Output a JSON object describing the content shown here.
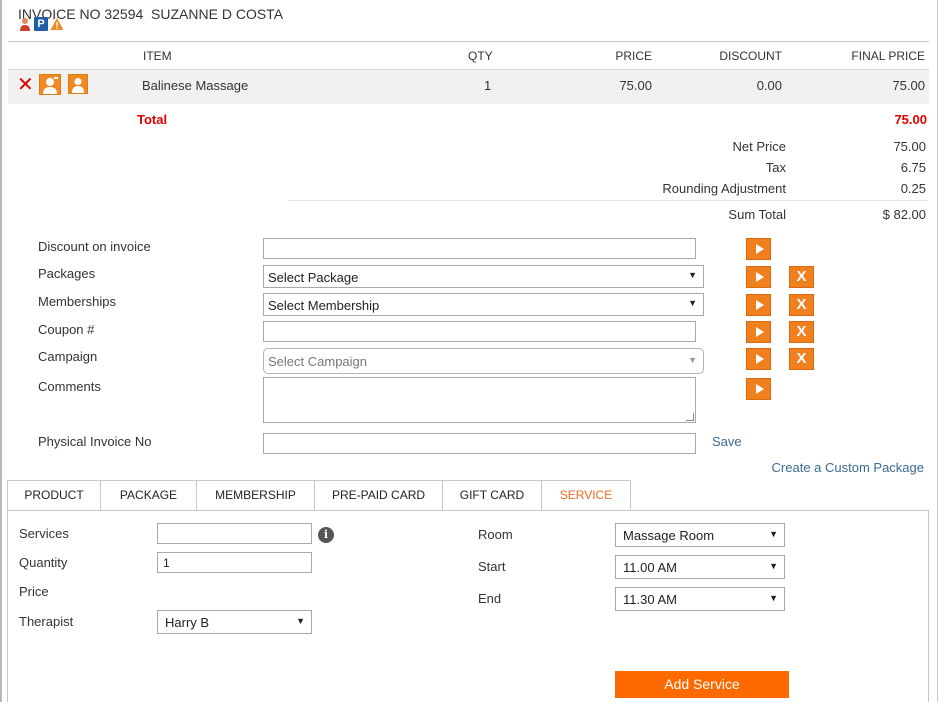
{
  "header": {
    "title": "INVOICE NO 32594  SUZANNE D COSTA",
    "icons": [
      "person-icon",
      "parking-icon",
      "warning-icon"
    ]
  },
  "table": {
    "columns": [
      "ITEM",
      "QTY",
      "PRICE",
      "DISCOUNT",
      "FINAL PRICE"
    ],
    "rows": [
      {
        "item": "Balinese Massage",
        "qty": "1",
        "price": "75.00",
        "discount": "0.00",
        "final_price": "75.00"
      }
    ],
    "total_label": "Total",
    "total_value": "75.00"
  },
  "summary": {
    "net_price_label": "Net Price",
    "net_price": "75.00",
    "tax_label": "Tax",
    "tax": "6.75",
    "rounding_label": "Rounding Adjustment",
    "rounding": "0.25",
    "sum_total_label": "Sum Total",
    "sum_total": "$ 82.00"
  },
  "form": {
    "discount_label": "Discount on invoice",
    "packages_label": "Packages",
    "packages_value": "Select Package",
    "memberships_label": "Memberships",
    "memberships_value": "Select Membership",
    "coupon_label": "Coupon #",
    "campaign_label": "Campaign",
    "campaign_value": "Select Campaign",
    "comments_label": "Comments",
    "physical_invoice_label": "Physical Invoice No",
    "save_link": "Save",
    "custom_package_link": "Create a Custom Package"
  },
  "tabs": [
    "PRODUCT",
    "PACKAGE",
    "MEMBERSHIP",
    "PRE-PAID CARD",
    "GIFT CARD",
    "SERVICE"
  ],
  "active_tab": "SERVICE",
  "service": {
    "services_label": "Services",
    "services_value": "",
    "quantity_label": "Quantity",
    "quantity_value": "1",
    "price_label": "Price",
    "therapist_label": "Therapist",
    "therapist_value": "Harry B",
    "room_label": "Room",
    "room_value": "Massage Room",
    "start_label": "Start",
    "start_value": "11.00 AM",
    "end_label": "End",
    "end_value": "11.30 AM",
    "add_button": "Add Service"
  },
  "colors": {
    "accent": "#f07f1e",
    "add_button": "#ff6a00",
    "total": "#e00000",
    "link": "#3a6b95",
    "active_tab": "#f06a1e"
  }
}
